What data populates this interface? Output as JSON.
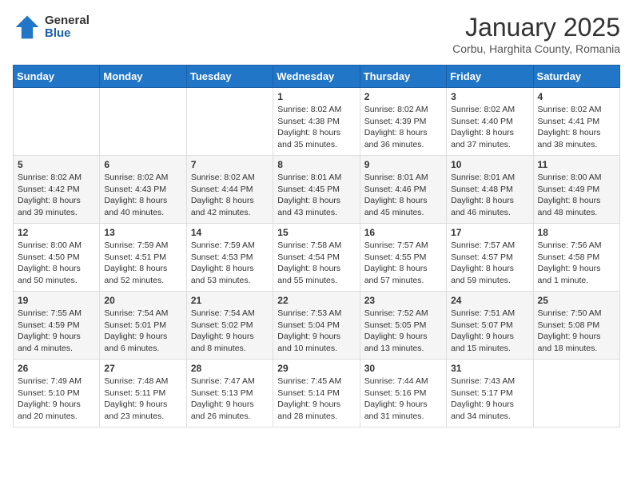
{
  "logo": {
    "general": "General",
    "blue": "Blue"
  },
  "title": "January 2025",
  "location": "Corbu, Harghita County, Romania",
  "days_header": [
    "Sunday",
    "Monday",
    "Tuesday",
    "Wednesday",
    "Thursday",
    "Friday",
    "Saturday"
  ],
  "weeks": [
    [
      {
        "day": "",
        "info": ""
      },
      {
        "day": "",
        "info": ""
      },
      {
        "day": "",
        "info": ""
      },
      {
        "day": "1",
        "info": "Sunrise: 8:02 AM\nSunset: 4:38 PM\nDaylight: 8 hours and 35 minutes."
      },
      {
        "day": "2",
        "info": "Sunrise: 8:02 AM\nSunset: 4:39 PM\nDaylight: 8 hours and 36 minutes."
      },
      {
        "day": "3",
        "info": "Sunrise: 8:02 AM\nSunset: 4:40 PM\nDaylight: 8 hours and 37 minutes."
      },
      {
        "day": "4",
        "info": "Sunrise: 8:02 AM\nSunset: 4:41 PM\nDaylight: 8 hours and 38 minutes."
      }
    ],
    [
      {
        "day": "5",
        "info": "Sunrise: 8:02 AM\nSunset: 4:42 PM\nDaylight: 8 hours and 39 minutes."
      },
      {
        "day": "6",
        "info": "Sunrise: 8:02 AM\nSunset: 4:43 PM\nDaylight: 8 hours and 40 minutes."
      },
      {
        "day": "7",
        "info": "Sunrise: 8:02 AM\nSunset: 4:44 PM\nDaylight: 8 hours and 42 minutes."
      },
      {
        "day": "8",
        "info": "Sunrise: 8:01 AM\nSunset: 4:45 PM\nDaylight: 8 hours and 43 minutes."
      },
      {
        "day": "9",
        "info": "Sunrise: 8:01 AM\nSunset: 4:46 PM\nDaylight: 8 hours and 45 minutes."
      },
      {
        "day": "10",
        "info": "Sunrise: 8:01 AM\nSunset: 4:48 PM\nDaylight: 8 hours and 46 minutes."
      },
      {
        "day": "11",
        "info": "Sunrise: 8:00 AM\nSunset: 4:49 PM\nDaylight: 8 hours and 48 minutes."
      }
    ],
    [
      {
        "day": "12",
        "info": "Sunrise: 8:00 AM\nSunset: 4:50 PM\nDaylight: 8 hours and 50 minutes."
      },
      {
        "day": "13",
        "info": "Sunrise: 7:59 AM\nSunset: 4:51 PM\nDaylight: 8 hours and 52 minutes."
      },
      {
        "day": "14",
        "info": "Sunrise: 7:59 AM\nSunset: 4:53 PM\nDaylight: 8 hours and 53 minutes."
      },
      {
        "day": "15",
        "info": "Sunrise: 7:58 AM\nSunset: 4:54 PM\nDaylight: 8 hours and 55 minutes."
      },
      {
        "day": "16",
        "info": "Sunrise: 7:57 AM\nSunset: 4:55 PM\nDaylight: 8 hours and 57 minutes."
      },
      {
        "day": "17",
        "info": "Sunrise: 7:57 AM\nSunset: 4:57 PM\nDaylight: 8 hours and 59 minutes."
      },
      {
        "day": "18",
        "info": "Sunrise: 7:56 AM\nSunset: 4:58 PM\nDaylight: 9 hours and 1 minute."
      }
    ],
    [
      {
        "day": "19",
        "info": "Sunrise: 7:55 AM\nSunset: 4:59 PM\nDaylight: 9 hours and 4 minutes."
      },
      {
        "day": "20",
        "info": "Sunrise: 7:54 AM\nSunset: 5:01 PM\nDaylight: 9 hours and 6 minutes."
      },
      {
        "day": "21",
        "info": "Sunrise: 7:54 AM\nSunset: 5:02 PM\nDaylight: 9 hours and 8 minutes."
      },
      {
        "day": "22",
        "info": "Sunrise: 7:53 AM\nSunset: 5:04 PM\nDaylight: 9 hours and 10 minutes."
      },
      {
        "day": "23",
        "info": "Sunrise: 7:52 AM\nSunset: 5:05 PM\nDaylight: 9 hours and 13 minutes."
      },
      {
        "day": "24",
        "info": "Sunrise: 7:51 AM\nSunset: 5:07 PM\nDaylight: 9 hours and 15 minutes."
      },
      {
        "day": "25",
        "info": "Sunrise: 7:50 AM\nSunset: 5:08 PM\nDaylight: 9 hours and 18 minutes."
      }
    ],
    [
      {
        "day": "26",
        "info": "Sunrise: 7:49 AM\nSunset: 5:10 PM\nDaylight: 9 hours and 20 minutes."
      },
      {
        "day": "27",
        "info": "Sunrise: 7:48 AM\nSunset: 5:11 PM\nDaylight: 9 hours and 23 minutes."
      },
      {
        "day": "28",
        "info": "Sunrise: 7:47 AM\nSunset: 5:13 PM\nDaylight: 9 hours and 26 minutes."
      },
      {
        "day": "29",
        "info": "Sunrise: 7:45 AM\nSunset: 5:14 PM\nDaylight: 9 hours and 28 minutes."
      },
      {
        "day": "30",
        "info": "Sunrise: 7:44 AM\nSunset: 5:16 PM\nDaylight: 9 hours and 31 minutes."
      },
      {
        "day": "31",
        "info": "Sunrise: 7:43 AM\nSunset: 5:17 PM\nDaylight: 9 hours and 34 minutes."
      },
      {
        "day": "",
        "info": ""
      }
    ]
  ]
}
